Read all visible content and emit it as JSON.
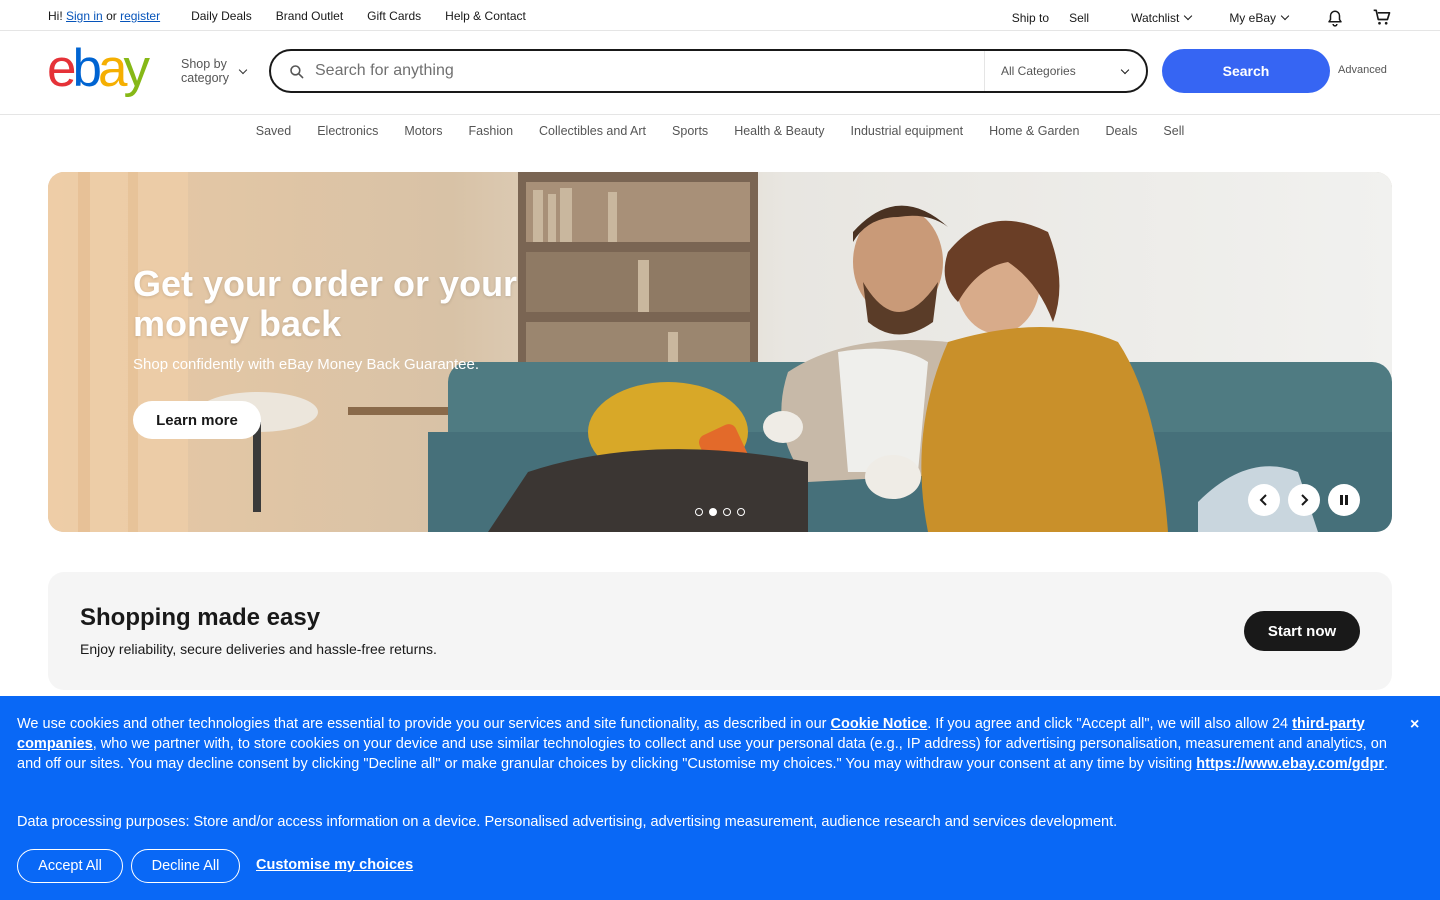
{
  "topbar": {
    "greeting_prefix": "Hi!",
    "sign_in": "Sign in",
    "or": "or",
    "register": "register",
    "links": [
      "Daily Deals",
      "Brand Outlet",
      "Gift Cards",
      "Help & Contact"
    ],
    "ship_to": "Ship to",
    "sell": "Sell",
    "watchlist": "Watchlist",
    "my_ebay": "My eBay"
  },
  "header": {
    "logo": [
      "e",
      "b",
      "a",
      "y"
    ],
    "shop_by_line1": "Shop by",
    "shop_by_line2": "category",
    "search_placeholder": "Search for anything",
    "category_select": "All Categories",
    "search_button": "Search",
    "advanced": "Advanced"
  },
  "nav": [
    "Saved",
    "Electronics",
    "Motors",
    "Fashion",
    "Collectibles and Art",
    "Sports",
    "Health & Beauty",
    "Industrial equipment",
    "Home & Garden",
    "Deals",
    "Sell"
  ],
  "hero": {
    "title": "Get your order or your money back",
    "subtitle": "Shop confidently with eBay Money Back Guarantee.",
    "cta": "Learn more",
    "slide_count": 4,
    "active_slide": 2
  },
  "promo": {
    "title": "Shopping made easy",
    "text": "Enjoy reliability, secure deliveries and hassle-free returns.",
    "cta": "Start now"
  },
  "cookie": {
    "p1": "We use cookies and other technologies that are essential to provide you our services and site functionality, as described in our ",
    "cookie_notice": "Cookie Notice",
    "p2": ". If you agree and click \"Accept all\", we will also allow 24 ",
    "third_party": "third-party companies",
    "p3": ", who we partner with, to store cookies on your device and use similar technologies to collect and use your personal data (e.g., IP address) for advertising personalisation, measurement and analytics, on and off our sites. You may decline consent by clicking \"Decline all\" or make granular choices by clicking \"Customise my choices.\" You may withdraw your consent at any time by visiting ",
    "gdpr_link": "https://www.ebay.com/gdpr",
    "p4": ".",
    "purposes": "Data processing purposes: Store and/or access information on a device. Personalised advertising, advertising measurement, audience research and services development.",
    "accept": "Accept All",
    "decline": "Decline All",
    "customise": "Customise my choices",
    "close": "×"
  },
  "colors": {
    "accent": "#3665f3",
    "cookie_bg": "#0968f6",
    "logo_e": "#e53238",
    "logo_b": "#0064d2",
    "logo_a": "#f5af02",
    "logo_y": "#86b817"
  }
}
